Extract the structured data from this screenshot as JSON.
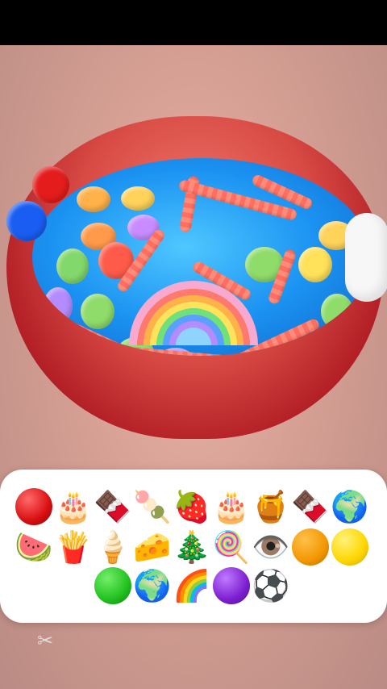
{
  "emoji_panel": {
    "rows": [
      [
        "🔴",
        "🎂",
        "🍫",
        "🍡",
        "🍓",
        "🎂",
        "🍯",
        "🍫",
        "🌍"
      ],
      [
        "🍉",
        "🍟",
        "🍦",
        "🧀",
        "🎄",
        "🍭",
        "👁️",
        "🟠",
        "🟡"
      ],
      [
        "🟢",
        "🌍",
        "🌈",
        "🟣",
        "⚽"
      ]
    ]
  },
  "colors": {
    "ball_red": "#d90f12",
    "ball_orange": "#f29700",
    "ball_yellow": "#ffd600",
    "ball_green": "#21c11f",
    "ball_purple": "#7d1fd1"
  },
  "watermark": {
    "icon": "capcut-logo-icon"
  }
}
